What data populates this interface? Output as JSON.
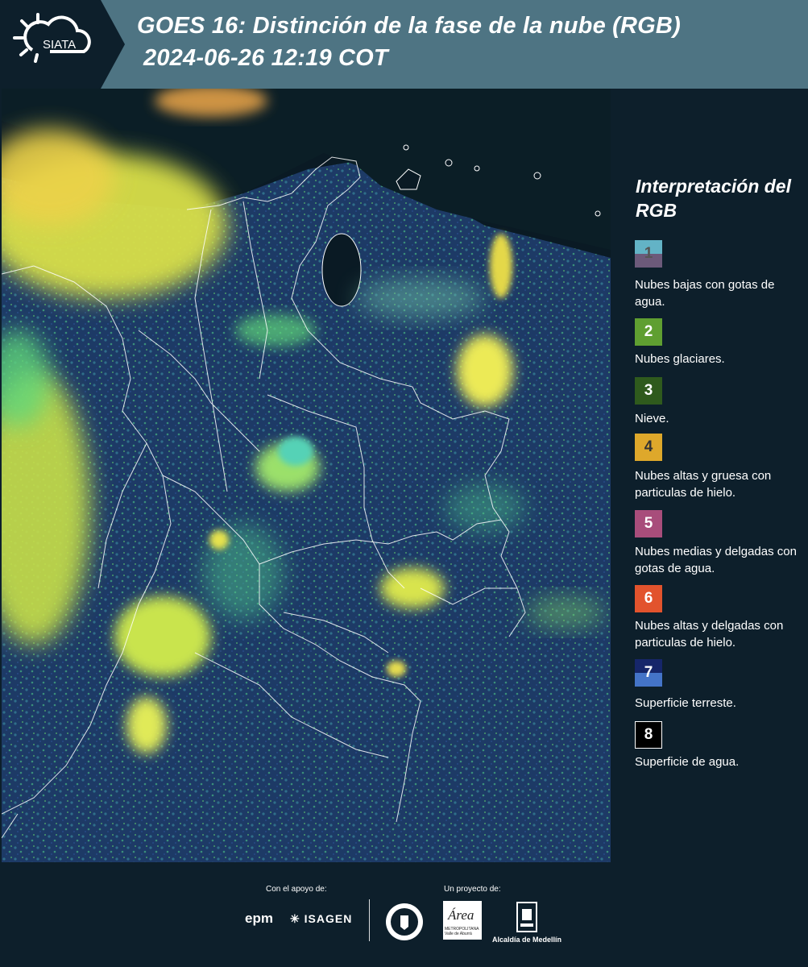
{
  "header": {
    "logo_text": "SIATA",
    "title_line1": "GOES 16: Distinción de la fase de la nube (RGB)",
    "title_line2": "2024-06-26 12:19 COT",
    "colors": {
      "header_bg": "#4e7483",
      "logo_bg": "#0d1f2b"
    }
  },
  "legend": {
    "title": "Interpretación del RGB",
    "items": [
      {
        "number": "1",
        "label": "Nubes bajas con gotas de agua.",
        "colors": [
          "#63b3c6",
          "#6c5a7a"
        ],
        "number_color": "#555555"
      },
      {
        "number": "2",
        "label": "Nubes glaciares.",
        "colors": [
          "#5f9f31"
        ],
        "number_color": "#ffffff"
      },
      {
        "number": "3",
        "label": "Nieve.",
        "colors": [
          "#2f5a1d"
        ],
        "number_color": "#ffffff"
      },
      {
        "number": "4",
        "label": "Nubes altas y gruesa con particulas de hielo.",
        "colors": [
          "#dea82b"
        ],
        "number_color": "#333333"
      },
      {
        "number": "5",
        "label": "Nubes medias y delgadas con gotas de agua.",
        "colors": [
          "#a84d7b"
        ],
        "number_color": "#ffffff"
      },
      {
        "number": "6",
        "label": "Nubes altas y delgadas con particulas de hielo.",
        "colors": [
          "#e2532d"
        ],
        "number_color": "#ffffff"
      },
      {
        "number": "7",
        "label": "Superficie terreste.",
        "colors": [
          "#16266a",
          "#4474c8"
        ],
        "number_color": "#ffffff"
      },
      {
        "number": "8",
        "label": "Superficie de agua.",
        "colors": [
          "#000000"
        ],
        "number_color": "#ffffff"
      }
    ]
  },
  "footer": {
    "support_label": "Con el apoyo de:",
    "project_label": "Un proyecto de:",
    "epm_text": "epm",
    "isagen_text": "ISAGEN",
    "area_text": "Área",
    "area_subtext": "METROPOLITANA Valle de Aburrá",
    "medellin_text": "Alcaldía de Medellín"
  },
  "map": {
    "colors": {
      "land": "#1c3560",
      "ocean": "#08151f",
      "cloud_ice": "#e5ea52",
      "cloud_glacier": "#5fd67a",
      "borders": "#ffffff"
    }
  }
}
